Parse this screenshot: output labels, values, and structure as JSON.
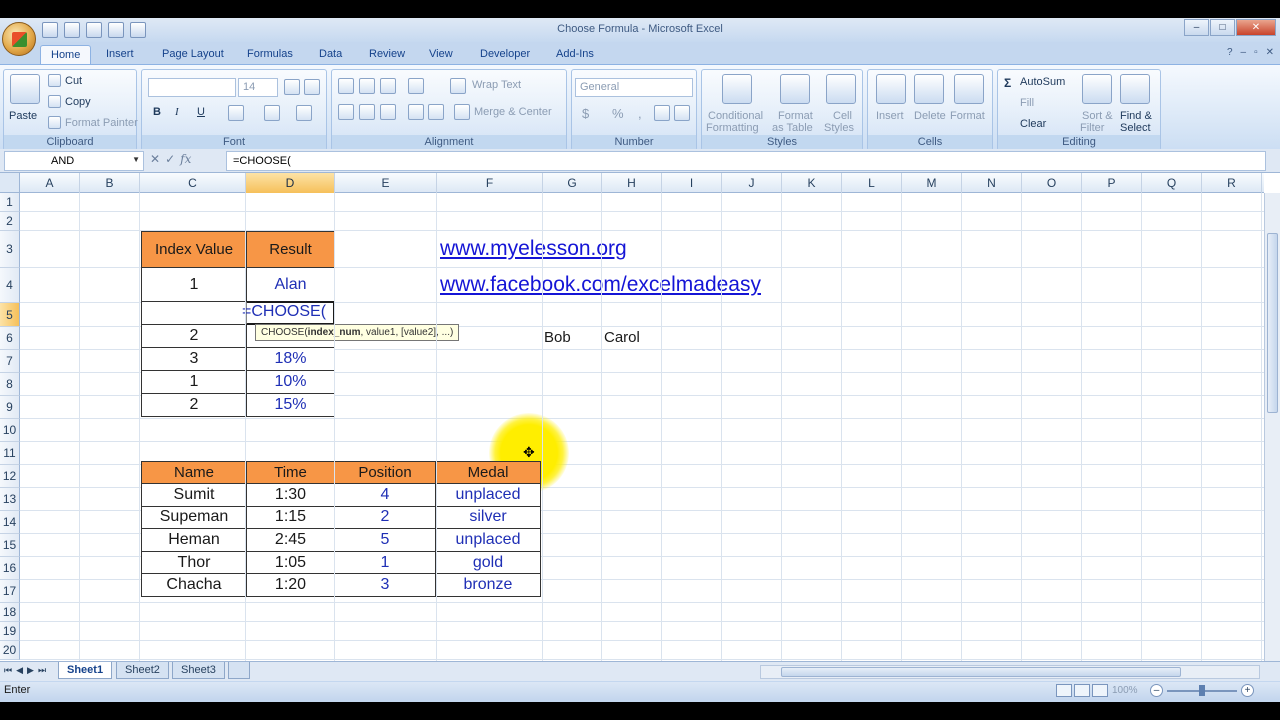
{
  "window": {
    "title": "Choose Formula - Microsoft Excel"
  },
  "ribbon_tabs": [
    "Home",
    "Insert",
    "Page Layout",
    "Formulas",
    "Data",
    "Review",
    "View",
    "Developer",
    "Add-Ins"
  ],
  "active_tab": "Home",
  "clipboard": {
    "paste": "Paste",
    "cut": "Cut",
    "copy": "Copy",
    "format_painter": "Format Painter",
    "group": "Clipboard"
  },
  "font": {
    "size": "14",
    "bold": "B",
    "italic": "I",
    "underline": "U",
    "group": "Font"
  },
  "alignment": {
    "wrap_text": "Wrap Text",
    "merge_center": "Merge & Center",
    "group": "Alignment"
  },
  "number": {
    "format": "General",
    "dollar": "$",
    "percent": "%",
    "comma": ",",
    "group": "Number"
  },
  "styles": {
    "conditional": "Conditional",
    "conditional2": "Formatting",
    "format_table": "Format",
    "format_table2": "as Table",
    "cell_styles": "Cell",
    "cell_styles2": "Styles",
    "group": "Styles"
  },
  "cells": {
    "insert": "Insert",
    "delete": "Delete",
    "format": "Format",
    "group": "Cells"
  },
  "editing": {
    "autosum": "AutoSum",
    "fill": "Fill",
    "clear": "Clear",
    "sort": "Sort &",
    "sort2": "Filter",
    "find": "Find &",
    "find2": "Select",
    "group": "Editing"
  },
  "formula_bar": {
    "name_box": "AND",
    "formula": "=CHOOSE(",
    "fx": "fx"
  },
  "columns": [
    "A",
    "B",
    "C",
    "D",
    "E",
    "F",
    "G",
    "H",
    "I",
    "J",
    "K",
    "L",
    "M",
    "N",
    "O",
    "P",
    "Q",
    "R"
  ],
  "rows": [
    "1",
    "2",
    "3",
    "4",
    "5",
    "6",
    "7",
    "8",
    "9",
    "10",
    "11",
    "12",
    "13",
    "14",
    "15",
    "16",
    "17",
    "18",
    "19",
    "20"
  ],
  "table1": {
    "headers": [
      "Index Value",
      "Result"
    ],
    "row4": [
      "1",
      "Alan"
    ],
    "editing_text": "=CHOOSE(",
    "tooltip_fn": "CHOOSE(",
    "tooltip_arg": "index_num",
    "tooltip_rest": ", value1, [value2], ...)",
    "rows": [
      [
        "2",
        ""
      ],
      [
        "3",
        "18%"
      ],
      [
        "1",
        "10%"
      ],
      [
        "2",
        "15%"
      ]
    ]
  },
  "links": [
    "www.myelesson.org",
    "www.facebook.com/excelmadeasy"
  ],
  "names": [
    "Bob",
    "Carol"
  ],
  "table2": {
    "headers": [
      "Name",
      "Time",
      "Position",
      "Medal"
    ],
    "rows": [
      [
        "Sumit",
        "1:30",
        "4",
        "unplaced"
      ],
      [
        "Supeman",
        "1:15",
        "2",
        "silver"
      ],
      [
        "Heman",
        "2:45",
        "5",
        "unplaced"
      ],
      [
        "Thor",
        "1:05",
        "1",
        "gold"
      ],
      [
        "Chacha",
        "1:20",
        "3",
        "bronze"
      ]
    ]
  },
  "sheets": [
    "Sheet1",
    "Sheet2",
    "Sheet3"
  ],
  "active_sheet": "Sheet1",
  "status": {
    "mode": "Enter",
    "zoom": "100%"
  }
}
